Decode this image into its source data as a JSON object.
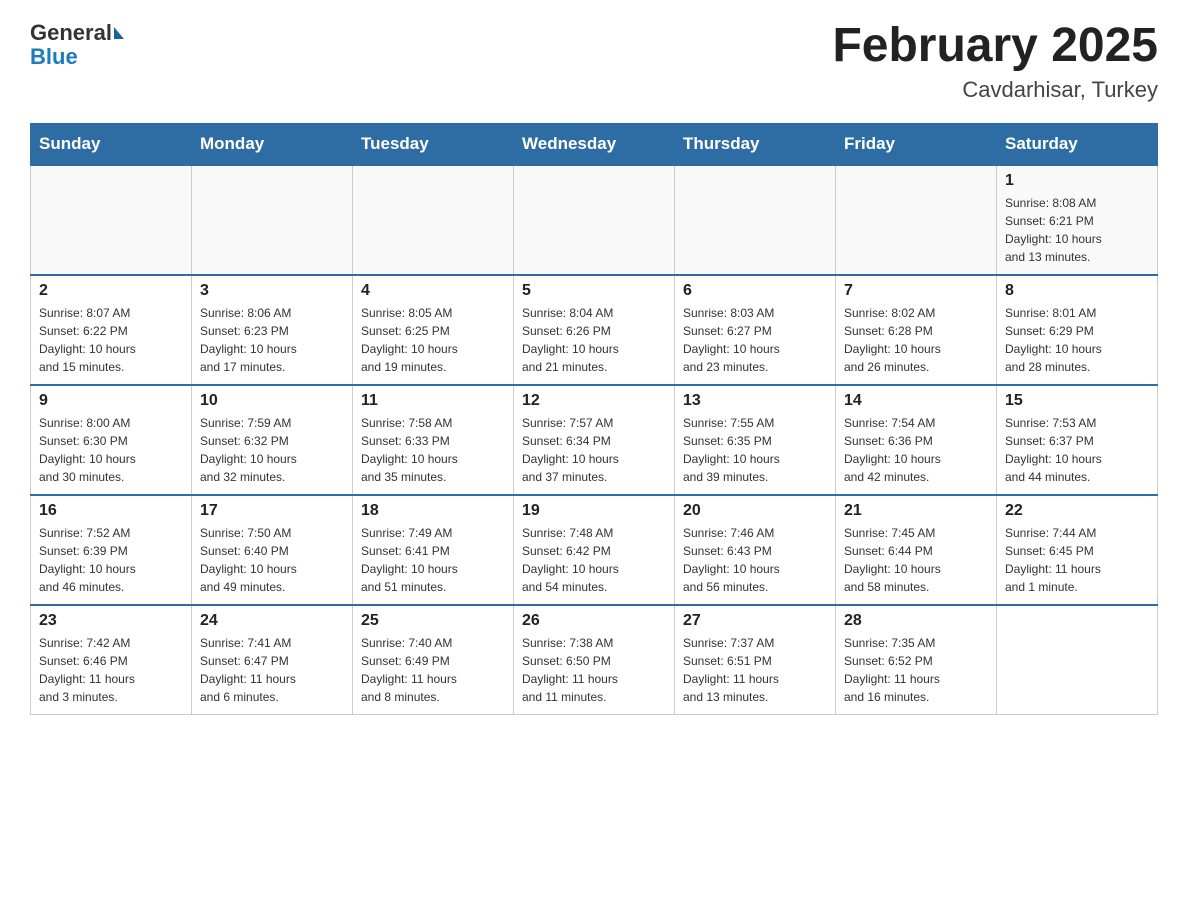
{
  "header": {
    "logo_general": "General",
    "logo_blue": "Blue",
    "month_title": "February 2025",
    "location": "Cavdarhisar, Turkey"
  },
  "days_of_week": [
    "Sunday",
    "Monday",
    "Tuesday",
    "Wednesday",
    "Thursday",
    "Friday",
    "Saturday"
  ],
  "weeks": [
    {
      "cells": [
        {
          "day": "",
          "info": ""
        },
        {
          "day": "",
          "info": ""
        },
        {
          "day": "",
          "info": ""
        },
        {
          "day": "",
          "info": ""
        },
        {
          "day": "",
          "info": ""
        },
        {
          "day": "",
          "info": ""
        },
        {
          "day": "1",
          "info": "Sunrise: 8:08 AM\nSunset: 6:21 PM\nDaylight: 10 hours\nand 13 minutes."
        }
      ]
    },
    {
      "cells": [
        {
          "day": "2",
          "info": "Sunrise: 8:07 AM\nSunset: 6:22 PM\nDaylight: 10 hours\nand 15 minutes."
        },
        {
          "day": "3",
          "info": "Sunrise: 8:06 AM\nSunset: 6:23 PM\nDaylight: 10 hours\nand 17 minutes."
        },
        {
          "day": "4",
          "info": "Sunrise: 8:05 AM\nSunset: 6:25 PM\nDaylight: 10 hours\nand 19 minutes."
        },
        {
          "day": "5",
          "info": "Sunrise: 8:04 AM\nSunset: 6:26 PM\nDaylight: 10 hours\nand 21 minutes."
        },
        {
          "day": "6",
          "info": "Sunrise: 8:03 AM\nSunset: 6:27 PM\nDaylight: 10 hours\nand 23 minutes."
        },
        {
          "day": "7",
          "info": "Sunrise: 8:02 AM\nSunset: 6:28 PM\nDaylight: 10 hours\nand 26 minutes."
        },
        {
          "day": "8",
          "info": "Sunrise: 8:01 AM\nSunset: 6:29 PM\nDaylight: 10 hours\nand 28 minutes."
        }
      ]
    },
    {
      "cells": [
        {
          "day": "9",
          "info": "Sunrise: 8:00 AM\nSunset: 6:30 PM\nDaylight: 10 hours\nand 30 minutes."
        },
        {
          "day": "10",
          "info": "Sunrise: 7:59 AM\nSunset: 6:32 PM\nDaylight: 10 hours\nand 32 minutes."
        },
        {
          "day": "11",
          "info": "Sunrise: 7:58 AM\nSunset: 6:33 PM\nDaylight: 10 hours\nand 35 minutes."
        },
        {
          "day": "12",
          "info": "Sunrise: 7:57 AM\nSunset: 6:34 PM\nDaylight: 10 hours\nand 37 minutes."
        },
        {
          "day": "13",
          "info": "Sunrise: 7:55 AM\nSunset: 6:35 PM\nDaylight: 10 hours\nand 39 minutes."
        },
        {
          "day": "14",
          "info": "Sunrise: 7:54 AM\nSunset: 6:36 PM\nDaylight: 10 hours\nand 42 minutes."
        },
        {
          "day": "15",
          "info": "Sunrise: 7:53 AM\nSunset: 6:37 PM\nDaylight: 10 hours\nand 44 minutes."
        }
      ]
    },
    {
      "cells": [
        {
          "day": "16",
          "info": "Sunrise: 7:52 AM\nSunset: 6:39 PM\nDaylight: 10 hours\nand 46 minutes."
        },
        {
          "day": "17",
          "info": "Sunrise: 7:50 AM\nSunset: 6:40 PM\nDaylight: 10 hours\nand 49 minutes."
        },
        {
          "day": "18",
          "info": "Sunrise: 7:49 AM\nSunset: 6:41 PM\nDaylight: 10 hours\nand 51 minutes."
        },
        {
          "day": "19",
          "info": "Sunrise: 7:48 AM\nSunset: 6:42 PM\nDaylight: 10 hours\nand 54 minutes."
        },
        {
          "day": "20",
          "info": "Sunrise: 7:46 AM\nSunset: 6:43 PM\nDaylight: 10 hours\nand 56 minutes."
        },
        {
          "day": "21",
          "info": "Sunrise: 7:45 AM\nSunset: 6:44 PM\nDaylight: 10 hours\nand 58 minutes."
        },
        {
          "day": "22",
          "info": "Sunrise: 7:44 AM\nSunset: 6:45 PM\nDaylight: 11 hours\nand 1 minute."
        }
      ]
    },
    {
      "cells": [
        {
          "day": "23",
          "info": "Sunrise: 7:42 AM\nSunset: 6:46 PM\nDaylight: 11 hours\nand 3 minutes."
        },
        {
          "day": "24",
          "info": "Sunrise: 7:41 AM\nSunset: 6:47 PM\nDaylight: 11 hours\nand 6 minutes."
        },
        {
          "day": "25",
          "info": "Sunrise: 7:40 AM\nSunset: 6:49 PM\nDaylight: 11 hours\nand 8 minutes."
        },
        {
          "day": "26",
          "info": "Sunrise: 7:38 AM\nSunset: 6:50 PM\nDaylight: 11 hours\nand 11 minutes."
        },
        {
          "day": "27",
          "info": "Sunrise: 7:37 AM\nSunset: 6:51 PM\nDaylight: 11 hours\nand 13 minutes."
        },
        {
          "day": "28",
          "info": "Sunrise: 7:35 AM\nSunset: 6:52 PM\nDaylight: 11 hours\nand 16 minutes."
        },
        {
          "day": "",
          "info": ""
        }
      ]
    }
  ]
}
